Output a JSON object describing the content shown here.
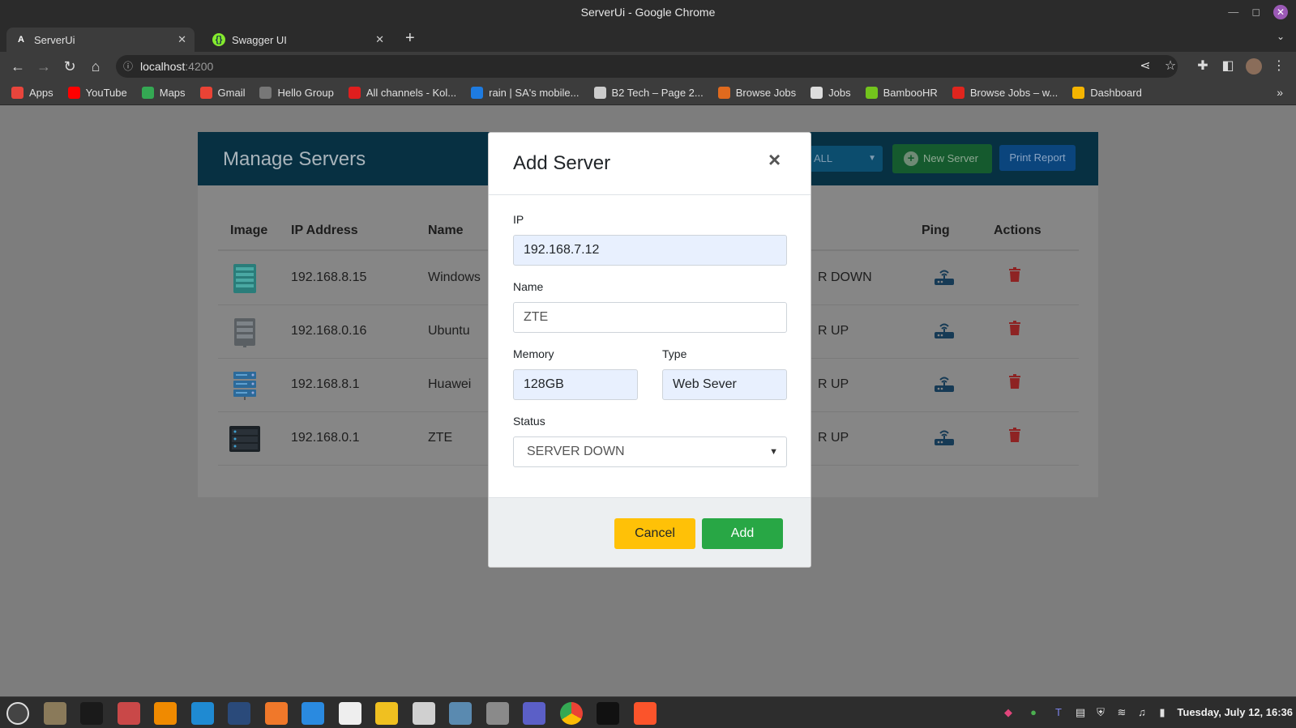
{
  "window": {
    "title": "ServerUi - Google Chrome"
  },
  "tabs": [
    {
      "label": "ServerUi",
      "favicon": "angular-icon",
      "active": true
    },
    {
      "label": "Swagger UI",
      "favicon": "swagger-icon",
      "active": false
    }
  ],
  "address": {
    "host": "localhost",
    "port": ":4200"
  },
  "bookmarks": [
    {
      "label": "Apps",
      "icon": "apps-grid-icon",
      "color": "#e8453c"
    },
    {
      "label": "YouTube",
      "icon": "youtube-icon",
      "color": "#ff0000"
    },
    {
      "label": "Maps",
      "icon": "maps-icon",
      "color": "#34a853"
    },
    {
      "label": "Gmail",
      "icon": "gmail-icon",
      "color": "#ea4335"
    },
    {
      "label": "Hello Group",
      "icon": "globe-icon",
      "color": "#777777"
    },
    {
      "label": "All channels - Kol...",
      "icon": "x-icon",
      "color": "#e01e1e"
    },
    {
      "label": "rain | SA's mobile...",
      "icon": "rain-icon",
      "color": "#1e7be0"
    },
    {
      "label": "B2 Tech – Page 2...",
      "icon": "page-icon",
      "color": "#cccccc"
    },
    {
      "label": "Browse Jobs",
      "icon": "pencil-icon",
      "color": "#e06a1e"
    },
    {
      "label": "Jobs",
      "icon": "doc-icon",
      "color": "#dddddd"
    },
    {
      "label": "BambooHR",
      "icon": "bamboo-icon",
      "color": "#73c41d"
    },
    {
      "label": "Browse Jobs – w...",
      "icon": "jobs-icon",
      "color": "#e0251e"
    },
    {
      "label": "Dashboard",
      "icon": "chart-icon",
      "color": "#f4b400"
    }
  ],
  "page": {
    "title": "Manage Servers",
    "filter_value": "ALL",
    "new_server_label": "New Server",
    "print_label": "Print Report",
    "columns": [
      "Image",
      "IP Address",
      "Name",
      "Ping",
      "Actions"
    ],
    "rows": [
      {
        "ip": "192.168.8.15",
        "name": "Windows",
        "status": "R DOWN",
        "image": "server-rack-teal"
      },
      {
        "ip": "192.168.0.16",
        "name": "Ubuntu",
        "status": "R UP",
        "image": "server-rack-gray"
      },
      {
        "ip": "192.168.8.1",
        "name": "Huawei",
        "status": "R UP",
        "image": "server-rack-blue"
      },
      {
        "ip": "192.168.0.1",
        "name": "ZTE",
        "status": "R UP",
        "image": "server-rack-dark"
      }
    ]
  },
  "modal": {
    "title": "Add Server",
    "close": "×",
    "ip_label": "IP",
    "ip_value": "192.168.7.12",
    "name_label": "Name",
    "name_value": "ZTE",
    "memory_label": "Memory",
    "memory_value": "128GB",
    "type_label": "Type",
    "type_value": "Web Sever",
    "status_label": "Status",
    "status_value": "SERVER DOWN",
    "cancel_label": "Cancel",
    "add_label": "Add"
  },
  "taskbar": {
    "clock": "Tuesday, July 12, 16:36",
    "apps": [
      {
        "name": "mint-menu-icon",
        "color": "#444444"
      },
      {
        "name": "files-icon",
        "color": "#8a7a5a"
      },
      {
        "name": "terminal-icon",
        "color": "#1a1a1a"
      },
      {
        "name": "archive-manager-icon",
        "color": "#c94848"
      },
      {
        "name": "vlc-icon",
        "color": "#f08a00"
      },
      {
        "name": "vscode-icon",
        "color": "#1f8ad2"
      },
      {
        "name": "mysql-workbench-icon",
        "color": "#2a4a7a"
      },
      {
        "name": "presentation-icon",
        "color": "#f0782a"
      },
      {
        "name": "writer-icon",
        "color": "#2a8ae0"
      },
      {
        "name": "mongodb-compass-icon",
        "color": "#eeeeee"
      },
      {
        "name": "wps-icon",
        "color": "#f0c020"
      },
      {
        "name": "chart-app-icon",
        "color": "#d0d0d0"
      },
      {
        "name": "screenshot-icon",
        "color": "#5a8ab0"
      },
      {
        "name": "calculator-icon",
        "color": "#8a8a8a"
      },
      {
        "name": "teams-icon",
        "color": "#5b5fc7"
      },
      {
        "name": "chrome-icon",
        "color": "#34a853"
      },
      {
        "name": "intellij-icon",
        "color": "#111111"
      },
      {
        "name": "brave-icon",
        "color": "#fb542b"
      }
    ]
  }
}
